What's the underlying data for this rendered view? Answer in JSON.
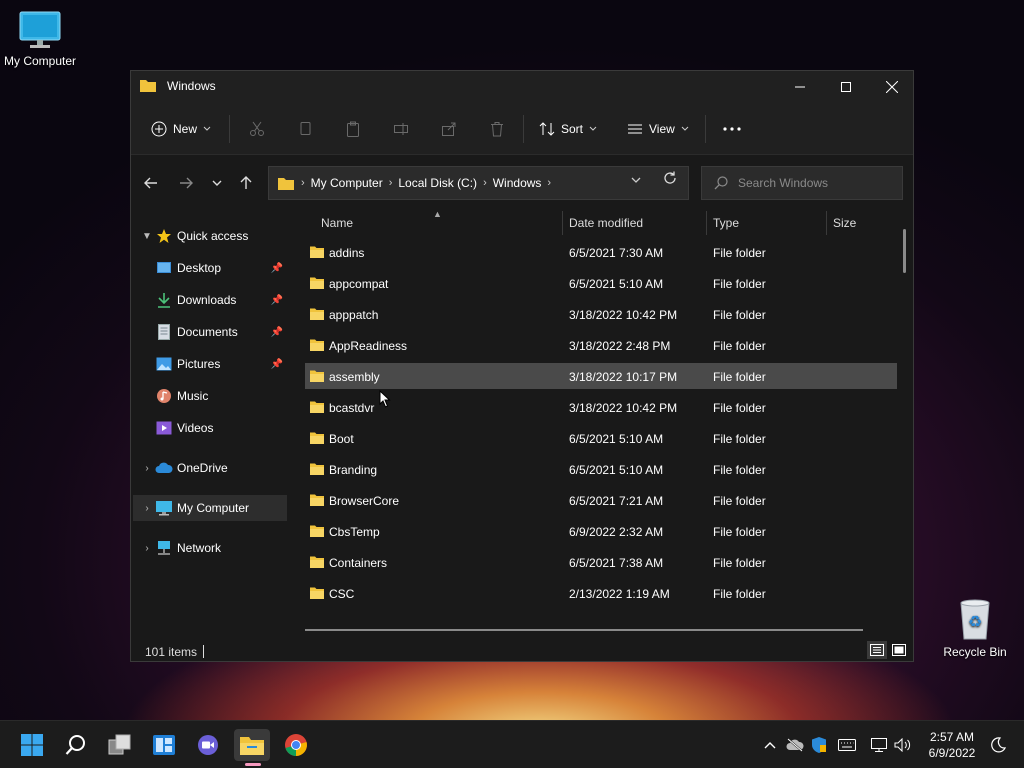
{
  "desktop": {
    "icons": [
      {
        "label": "My Computer"
      },
      {
        "label": "Recycle Bin"
      }
    ]
  },
  "window": {
    "title": "Windows",
    "toolbar": {
      "new_label": "New",
      "sort_label": "Sort",
      "view_label": "View"
    },
    "address": {
      "crumbs": [
        "My Computer",
        "Local Disk (C:)",
        "Windows"
      ]
    },
    "search": {
      "placeholder": "Search Windows"
    },
    "sidebar": {
      "items": [
        {
          "label": "Quick access"
        },
        {
          "label": "Desktop"
        },
        {
          "label": "Downloads"
        },
        {
          "label": "Documents"
        },
        {
          "label": "Pictures"
        },
        {
          "label": "Music"
        },
        {
          "label": "Videos"
        },
        {
          "label": "OneDrive"
        },
        {
          "label": "My Computer"
        },
        {
          "label": "Network"
        }
      ]
    },
    "columns": [
      "Name",
      "Date modified",
      "Type",
      "Size"
    ],
    "files": [
      {
        "name": "addins",
        "date": "6/5/2021 7:30 AM",
        "type": "File folder"
      },
      {
        "name": "appcompat",
        "date": "6/5/2021 5:10 AM",
        "type": "File folder"
      },
      {
        "name": "apppatch",
        "date": "3/18/2022 10:42 PM",
        "type": "File folder"
      },
      {
        "name": "AppReadiness",
        "date": "3/18/2022 2:48 PM",
        "type": "File folder"
      },
      {
        "name": "assembly",
        "date": "3/18/2022 10:17 PM",
        "type": "File folder"
      },
      {
        "name": "bcastdvr",
        "date": "3/18/2022 10:42 PM",
        "type": "File folder"
      },
      {
        "name": "Boot",
        "date": "6/5/2021 5:10 AM",
        "type": "File folder"
      },
      {
        "name": "Branding",
        "date": "6/5/2021 5:10 AM",
        "type": "File folder"
      },
      {
        "name": "BrowserCore",
        "date": "6/5/2021 7:21 AM",
        "type": "File folder"
      },
      {
        "name": "CbsTemp",
        "date": "6/9/2022 2:32 AM",
        "type": "File folder"
      },
      {
        "name": "Containers",
        "date": "6/5/2021 7:38 AM",
        "type": "File folder"
      },
      {
        "name": "CSC",
        "date": "2/13/2022 1:19 AM",
        "type": "File folder"
      }
    ],
    "status": {
      "count": "101 items"
    }
  },
  "taskbar": {
    "clock": {
      "time": "2:57 AM",
      "date": "6/9/2022"
    }
  },
  "colors": {
    "folder": "#f0c33c",
    "accent": "#4cc2ff"
  }
}
